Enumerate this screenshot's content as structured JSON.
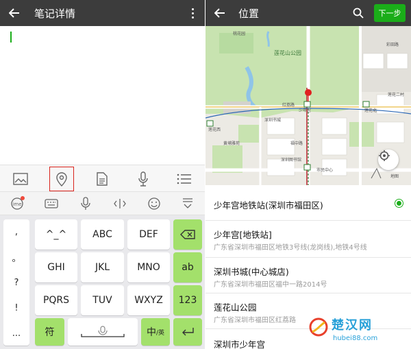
{
  "left": {
    "title": "笔记详情",
    "keyboard": {
      "symbols": [
        ",",
        "。",
        "?",
        "!",
        "..."
      ],
      "row1": [
        "^_^",
        "ABC",
        "DEF"
      ],
      "row2": [
        "GHI",
        "JKL",
        "MNO"
      ],
      "row3": [
        "PQRS",
        "TUV",
        "WXYZ"
      ],
      "ab_key": "ab",
      "num_key": "123",
      "symbol_key": "符",
      "lang_key_main": "中",
      "lang_key_sub": "/英"
    }
  },
  "right": {
    "title": "位置",
    "next_button": "下一步",
    "map_labels": {
      "park": "莲花山公园",
      "station": "少年宫",
      "l1": "红荔路",
      "l2": "深圳书城",
      "l3": "市民中心",
      "l4": "莲花二村",
      "l5": "莲花北",
      "l6": "桃花园",
      "l7": "深圳图书馆",
      "l8": "平安",
      "l9": "莲花西",
      "l10": "黄埔雅苑",
      "l11": "福中路",
      "l12": "彩田路",
      "l13": "地图"
    },
    "places": [
      {
        "name": "少年宫地铁站(深圳市福田区)",
        "address": ""
      },
      {
        "name": "少年宫[地铁站]",
        "address": "广东省深圳市福田区地铁3号线(龙岗线),地铁4号线"
      },
      {
        "name": "深圳书城(中心城店)",
        "address": "广东省深圳市福田区福中一路2014号"
      },
      {
        "name": "莲花山公园",
        "address": "广东省深圳市福田区红荔路"
      },
      {
        "name": "深圳市少年宫",
        "address": ""
      }
    ]
  },
  "watermark": {
    "cn": "楚汉网",
    "en": "hubei88.com"
  },
  "colors": {
    "accent": "#1aad19",
    "toolbar": "#3c3c3c",
    "key_green": "#a3e06b",
    "selection_outline": "#d9221b"
  }
}
